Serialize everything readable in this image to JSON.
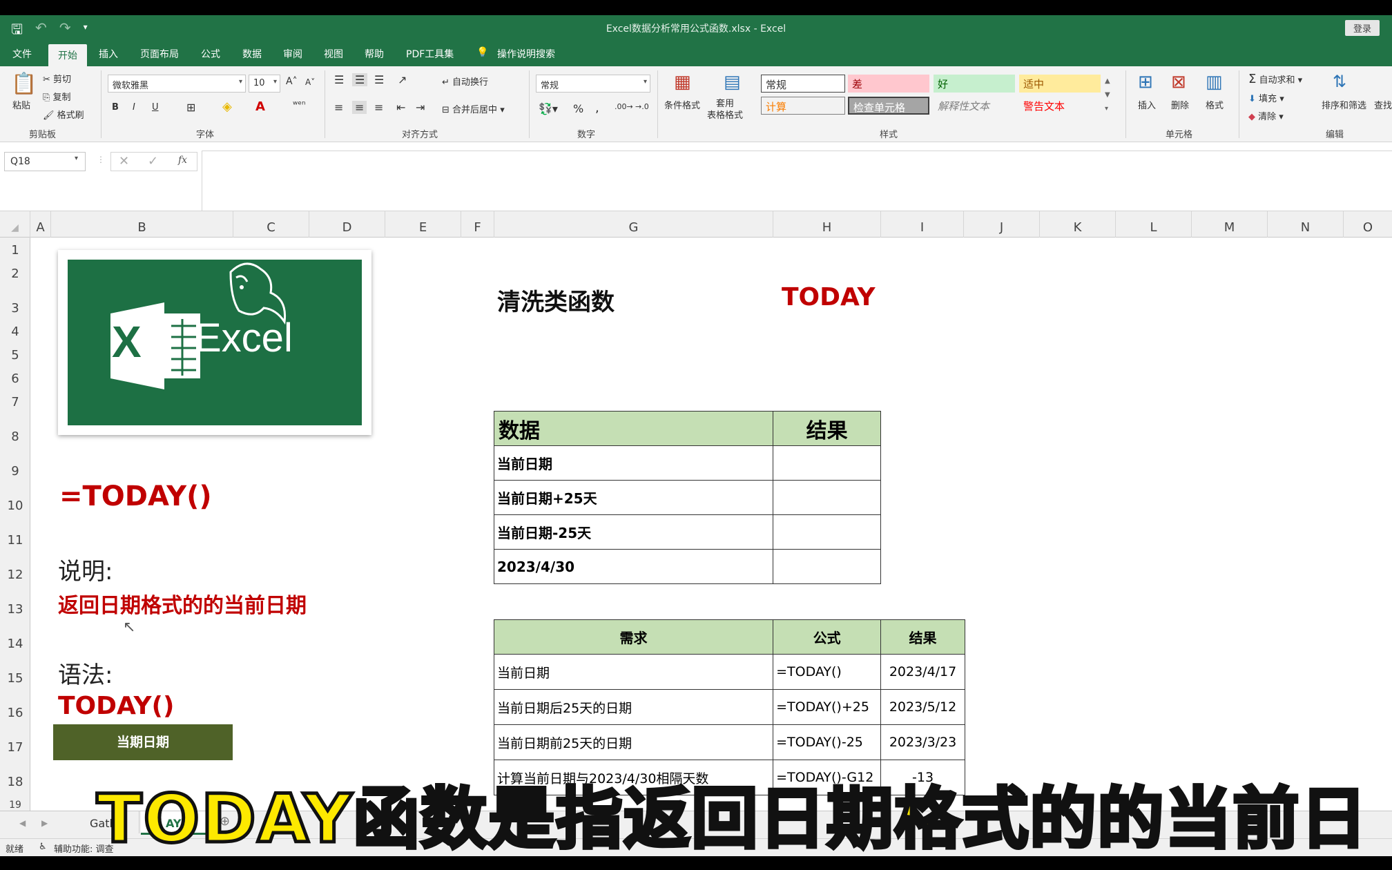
{
  "window": {
    "title": "Excel数据分析常用公式函数.xlsx  -  Excel",
    "login": "登录"
  },
  "menu": {
    "tabs": [
      "文件",
      "开始",
      "插入",
      "页面布局",
      "公式",
      "数据",
      "审阅",
      "视图",
      "帮助",
      "PDF工具集",
      "操作说明搜索"
    ]
  },
  "ribbon": {
    "clipboard": {
      "paste": "粘贴",
      "cut": "剪切",
      "copy": "复制",
      "format_painter": "格式刷",
      "label": "剪贴板"
    },
    "font": {
      "name": "微软雅黑",
      "size": "10",
      "label": "字体",
      "bold": "B",
      "italic": "I",
      "underline": "U"
    },
    "align": {
      "wrap": "自动换行",
      "merge": "合并后居中",
      "label": "对齐方式"
    },
    "number": {
      "format": "常规",
      "percent": "%",
      "comma": ",",
      "label": "数字"
    },
    "styles": {
      "cond": "条件格式",
      "table": "套用\n表格格式",
      "normal": "常规",
      "bad": "差",
      "good": "好",
      "neutral": "适中",
      "calc": "计算",
      "check": "检查单元格",
      "explain": "解释性文本",
      "warn": "警告文本",
      "label": "样式"
    },
    "cells": {
      "insert": "插入",
      "delete": "删除",
      "format": "格式",
      "label": "单元格"
    },
    "editing": {
      "autosum": "自动求和",
      "fill": "填充",
      "clear": "清除",
      "sort": "排序和筛选",
      "find": "查找",
      "label": "编辑"
    }
  },
  "formula_bar": {
    "name_box": "Q18",
    "fx": "fx"
  },
  "columns": [
    "A",
    "B",
    "C",
    "D",
    "E",
    "F",
    "G",
    "H",
    "I",
    "J",
    "K",
    "L",
    "M",
    "N",
    "O"
  ],
  "rows": [
    "1",
    "2",
    "3",
    "4",
    "5",
    "6",
    "7",
    "8",
    "9",
    "10",
    "11",
    "12",
    "13",
    "14",
    "15",
    "16",
    "17",
    "18",
    "19"
  ],
  "sheet": {
    "logo_text": "Excel",
    "logo_x": "X",
    "formula": "=TODAY()",
    "desc_label": "说明:",
    "desc": "返回日期格式的的当前日期",
    "syntax_label": "语法:",
    "syntax": "TODAY()",
    "button": "当期日期",
    "section_title": "清洗类函数",
    "func_name": "TODAY",
    "table1": {
      "headers": [
        "数据",
        "结果"
      ],
      "rows": [
        "当前日期",
        "当前日期+25天",
        "当前日期-25天",
        "2023/4/30"
      ]
    },
    "table2": {
      "headers": [
        "需求",
        "公式",
        "结果"
      ],
      "rows": [
        [
          "当前日期",
          "=TODAY()",
          "2023/4/17"
        ],
        [
          "当前日期后25天的日期",
          "=TODAY()+25",
          "2023/5/12"
        ],
        [
          "当前日期前25天的日期",
          "=TODAY()-25",
          "2023/3/23"
        ],
        [
          "计算当前日期与2023/4/30相隔天数",
          "=TODAY()-G12",
          "-13"
        ]
      ]
    }
  },
  "tabs": {
    "sheet1": "Gathe",
    "sheet2": "AY"
  },
  "status": {
    "ready": "就绪",
    "accessibility": "辅助功能: 调查"
  },
  "subtitle": "TODAY函数是指返回日期格式的的当前日"
}
